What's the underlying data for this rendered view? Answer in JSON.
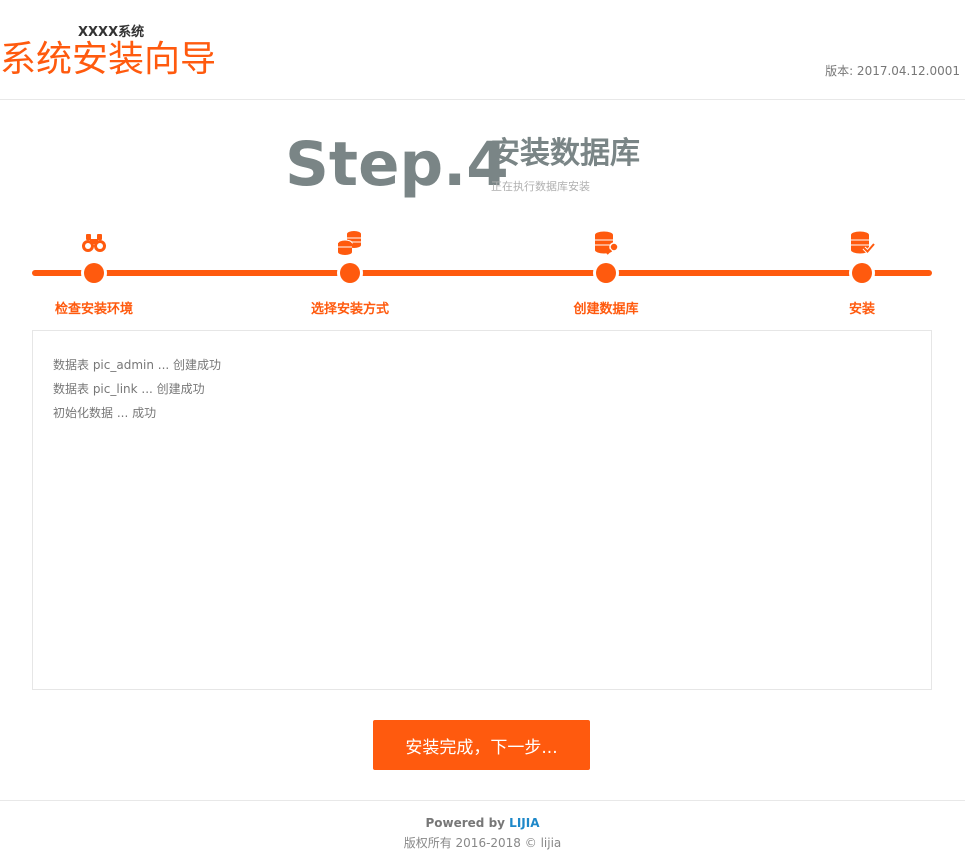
{
  "header": {
    "system_name": "XXXX系统",
    "title": "系统安装向导",
    "version": "版本: 2017.04.12.0001"
  },
  "step": {
    "number": "Step.4",
    "title": "安装数据库",
    "subtitle": "正在执行数据库安装"
  },
  "accent_color": "#ff5a0e",
  "steps": [
    {
      "label": "检查安装环境",
      "icon": "binoculars-icon"
    },
    {
      "label": "选择安装方式",
      "icon": "coins-icon"
    },
    {
      "label": "创建数据库",
      "icon": "database-key-icon"
    },
    {
      "label": "安装",
      "icon": "database-check-icon"
    }
  ],
  "log_lines": [
    "数据表 pic_admin ... 创建成功",
    "数据表 pic_link ... 创建成功",
    "初始化数据 ... 成功"
  ],
  "next_button": "安装完成，下一步...",
  "footer": {
    "powered_prefix": "Powered by ",
    "powered_brand": "LIJIA",
    "copyright": "版权所有 2016-2018 © lijia"
  }
}
